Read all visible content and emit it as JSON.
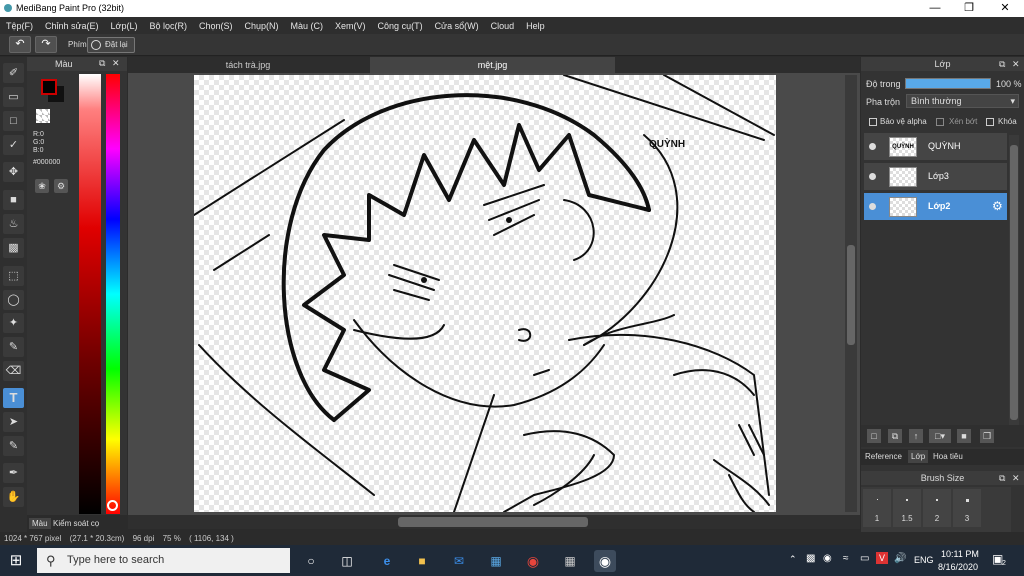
{
  "window": {
    "title": "MediBang Paint Pro (32bit)"
  },
  "menu": [
    "Tệp(F)",
    "Chỉnh sửa(E)",
    "Lớp(L)",
    "Bộ lọc(R)",
    "Chọn(S)",
    "Chụp(N)",
    "Màu (C)",
    "Xem(V)",
    "Công cụ(T)",
    "Cửa sổ(W)",
    "Cloud",
    "Help"
  ],
  "toolbar": {
    "phim_label": "Phím",
    "reset_label": "Đặt lại"
  },
  "colorpanel": {
    "title": "Màu",
    "r": "R:0",
    "g": "G:0",
    "b": "B:0",
    "hex": "#000000",
    "tab_color": "Màu",
    "tab_brush": "Kiểm soát cọ"
  },
  "tabs": [
    "tách trà.jpg",
    "mệt.jpg"
  ],
  "canvas_text": "QUỲNH",
  "rightpanel": {
    "title": "Lớp",
    "opacity_label": "Độ trong",
    "opacity_value": "100 %",
    "opacity_fraction": 1.0,
    "blend_label": "Pha trộn",
    "blend_value": "Bình thường",
    "protect_alpha": "Bảo vệ alpha",
    "clip": "Xén bớt",
    "lock": "Khóa",
    "layers": [
      {
        "name": "QUỲNH",
        "thumb_text": "QUỲNH",
        "selected": false
      },
      {
        "name": "Lớp3",
        "thumb_text": "",
        "selected": false
      },
      {
        "name": "Lớp2",
        "thumb_text": "",
        "selected": true
      }
    ],
    "bottom_tabs": [
      "Reference",
      "Lớp",
      "Hoa tiêu"
    ],
    "brush_size_title": "Brush Size",
    "brush_sizes": [
      "1",
      "1.5",
      "2",
      "3"
    ]
  },
  "status": {
    "size": "1024 * 767 pixel",
    "cm": "(27.1 * 20.3cm)",
    "dpi": "96 dpi",
    "zoom": "75 %",
    "coords": "( 1106, 134 )"
  },
  "taskbar": {
    "search_placeholder": "Type here to search",
    "lang": "ENG",
    "time": "10:11 PM",
    "date": "8/16/2020",
    "notif_count": "2"
  },
  "colors": {
    "accent": "#4a8fd6",
    "fg_color": "#000000",
    "bg_color": "#ffffff",
    "fg_border": "#cc0000"
  }
}
